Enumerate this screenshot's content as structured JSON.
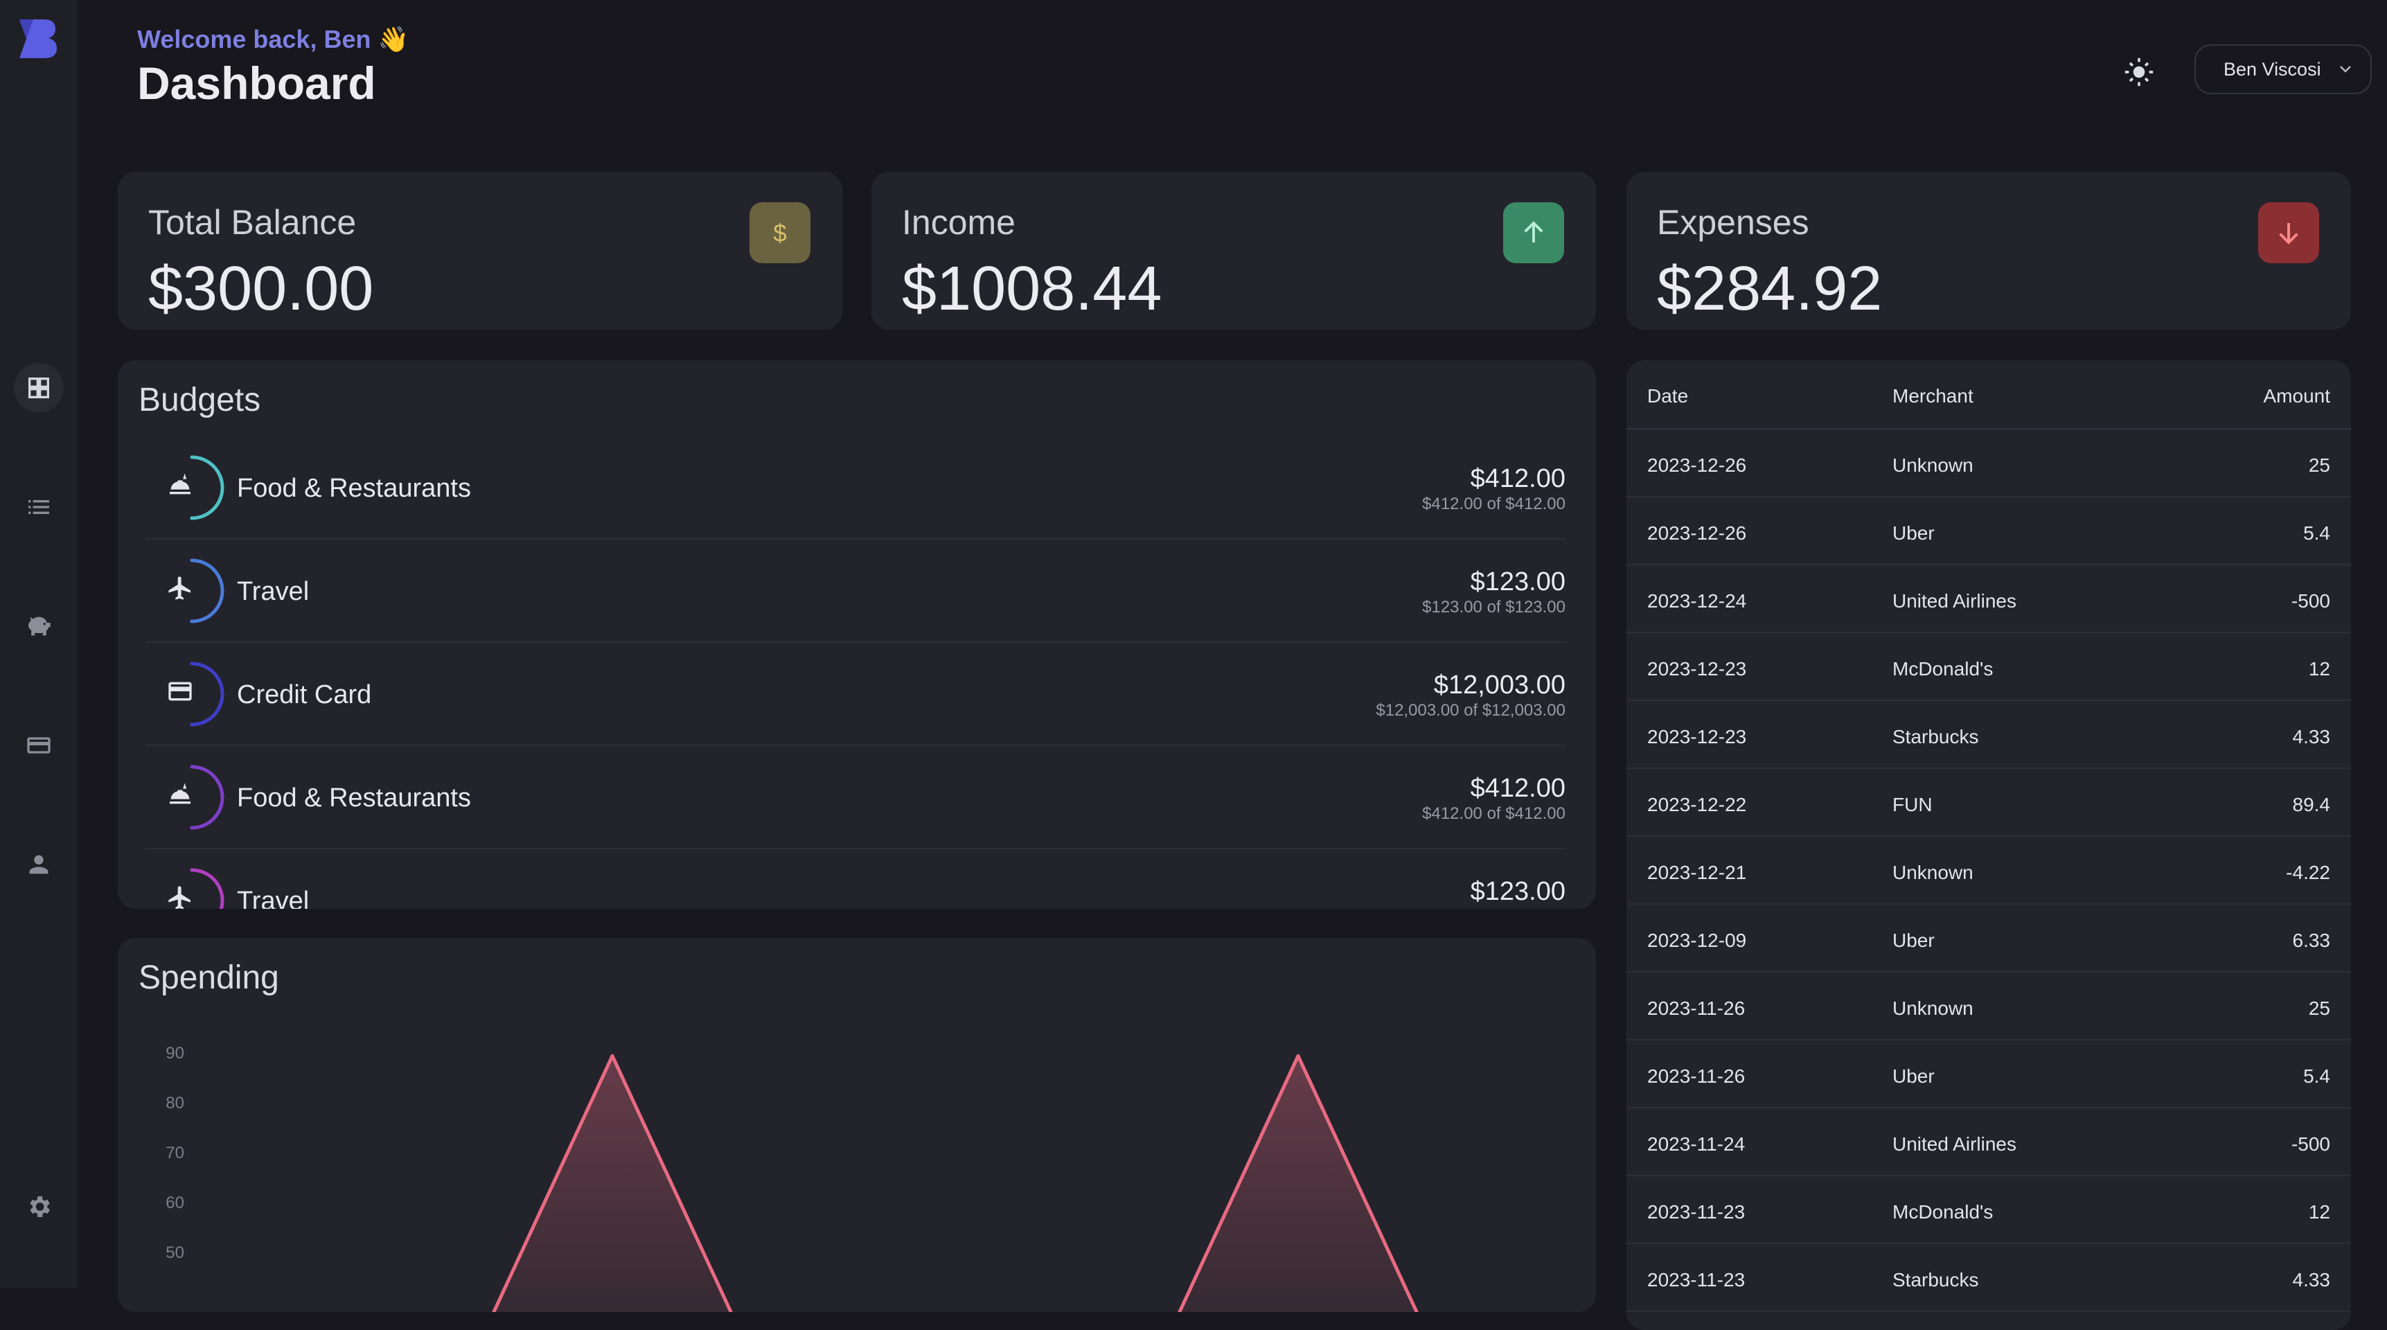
{
  "header": {
    "welcome": "Welcome back, Ben 👋",
    "title": "Dashboard",
    "user_name": "Ben Viscosi"
  },
  "sidebar": {
    "items": [
      {
        "name": "dashboard",
        "icon": "grid-icon",
        "active": true
      },
      {
        "name": "transactions",
        "icon": "list-icon",
        "active": false
      },
      {
        "name": "budgets",
        "icon": "piggy-bank-icon",
        "active": false
      },
      {
        "name": "accounts",
        "icon": "wallet-icon",
        "active": false
      },
      {
        "name": "profile",
        "icon": "person-icon",
        "active": false
      },
      {
        "name": "settings",
        "icon": "gear-icon",
        "active": false
      }
    ]
  },
  "stats": {
    "balance": {
      "label": "Total Balance",
      "value": "$300.00",
      "icon": "dollar-icon",
      "color": "#6b6340"
    },
    "income": {
      "label": "Income",
      "value": "$1008.44",
      "icon": "arrow-up-icon",
      "color": "#3a8a66"
    },
    "expenses": {
      "label": "Expenses",
      "value": "$284.92",
      "icon": "arrow-down-icon",
      "color": "#8c2f33"
    }
  },
  "budgets": {
    "title": "Budgets",
    "items": [
      {
        "name": "Food & Restaurants",
        "amount": "$412.00",
        "detail": "$412.00 of $412.00",
        "icon": "food-icon",
        "color": "#4fc1c6",
        "progress": 0.5
      },
      {
        "name": "Travel",
        "amount": "$123.00",
        "detail": "$123.00 of $123.00",
        "icon": "airplane-icon",
        "color": "#4a7bd8",
        "progress": 0.5
      },
      {
        "name": "Credit Card",
        "amount": "$12,003.00",
        "detail": "$12,003.00 of $12,003.00",
        "icon": "credit-card-icon",
        "color": "#3d3fc8",
        "progress": 0.5
      },
      {
        "name": "Food & Restaurants",
        "amount": "$412.00",
        "detail": "$412.00 of $412.00",
        "icon": "food-icon",
        "color": "#7e3fc6",
        "progress": 0.5
      },
      {
        "name": "Travel",
        "amount": "$123.00",
        "detail": "",
        "icon": "airplane-icon",
        "color": "#b040c0",
        "progress": 0.5
      }
    ]
  },
  "spending": {
    "title": "Spending"
  },
  "chart_data": {
    "type": "area",
    "title": "",
    "xlabel": "",
    "ylabel": "",
    "y_ticks": [
      "90",
      "80",
      "70",
      "60",
      "50"
    ],
    "ylim": [
      30,
      95
    ],
    "x": [
      0,
      1,
      2,
      3,
      4,
      5,
      6,
      7,
      8,
      9,
      10
    ],
    "values": [
      0,
      0,
      0,
      89.4,
      0,
      0,
      0,
      0,
      89.4,
      0,
      0
    ],
    "color": "#e86a82",
    "grid": false
  },
  "transactions": {
    "headers": {
      "date": "Date",
      "merchant": "Merchant",
      "amount": "Amount"
    },
    "rows": [
      {
        "date": "2023-12-26",
        "merchant": "Unknown",
        "amount": "25"
      },
      {
        "date": "2023-12-26",
        "merchant": "Uber",
        "amount": "5.4"
      },
      {
        "date": "2023-12-24",
        "merchant": "United Airlines",
        "amount": "-500"
      },
      {
        "date": "2023-12-23",
        "merchant": "McDonald's",
        "amount": "12"
      },
      {
        "date": "2023-12-23",
        "merchant": "Starbucks",
        "amount": "4.33"
      },
      {
        "date": "2023-12-22",
        "merchant": "FUN",
        "amount": "89.4"
      },
      {
        "date": "2023-12-21",
        "merchant": "Unknown",
        "amount": "-4.22"
      },
      {
        "date": "2023-12-09",
        "merchant": "Uber",
        "amount": "6.33"
      },
      {
        "date": "2023-11-26",
        "merchant": "Unknown",
        "amount": "25"
      },
      {
        "date": "2023-11-26",
        "merchant": "Uber",
        "amount": "5.4"
      },
      {
        "date": "2023-11-24",
        "merchant": "United Airlines",
        "amount": "-500"
      },
      {
        "date": "2023-11-23",
        "merchant": "McDonald's",
        "amount": "12"
      },
      {
        "date": "2023-11-23",
        "merchant": "Starbucks",
        "amount": "4.33"
      }
    ]
  }
}
